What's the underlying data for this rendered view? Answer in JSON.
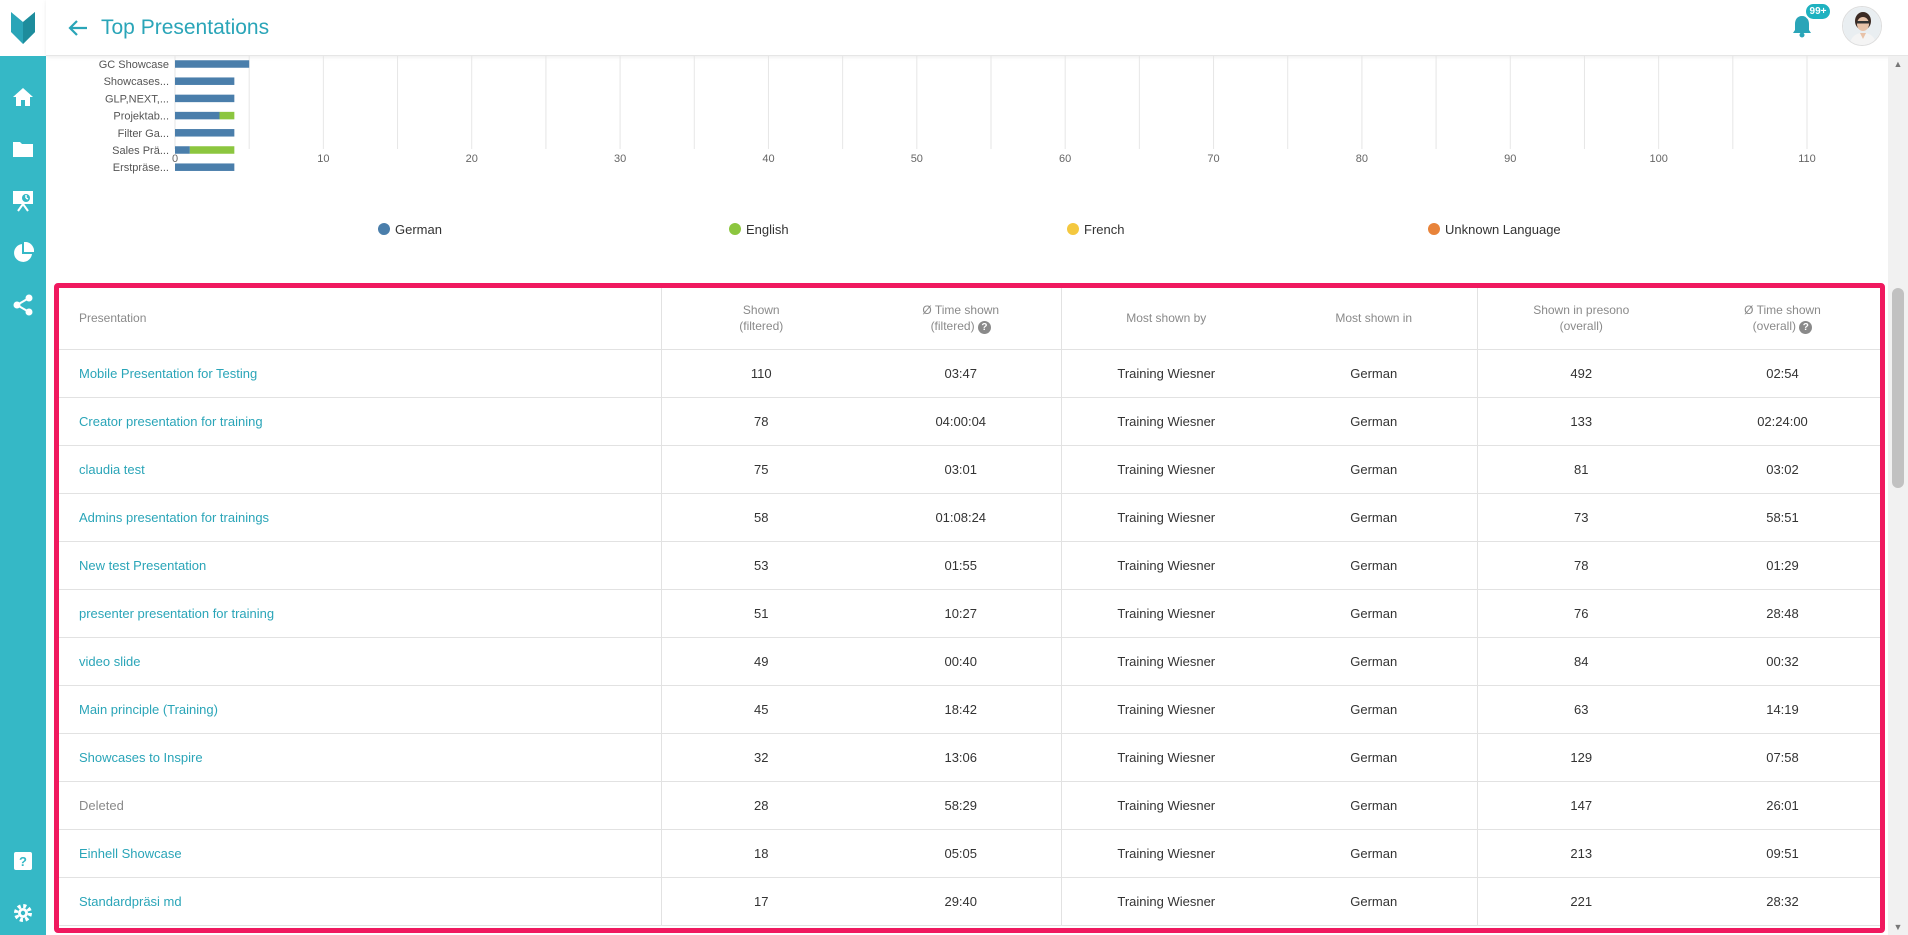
{
  "header": {
    "title": "Top Presentations",
    "notification_badge": "99+"
  },
  "sidebar": {
    "items": [
      "home-icon",
      "folder-icon",
      "presentation-icon",
      "pie-chart-icon",
      "share-icon",
      "help-icon",
      "settings-icon"
    ]
  },
  "chart_data": {
    "type": "bar",
    "orientation": "horizontal",
    "stacked": true,
    "categories": [
      "GC Showcase",
      "Showcases...",
      "GLP,NEXT,...",
      "Projektab...",
      "Filter Ga...",
      "Sales Prä...",
      "Erstpräse..."
    ],
    "series": [
      {
        "name": "German",
        "color": "#4a7eab",
        "values": [
          5,
          4,
          4,
          3,
          4,
          1,
          4
        ]
      },
      {
        "name": "English",
        "color": "#8cc63f",
        "values": [
          0,
          0,
          0,
          1,
          0,
          3,
          0
        ]
      },
      {
        "name": "French",
        "color": "#f4c83f",
        "values": [
          0,
          0,
          0,
          0,
          0,
          0,
          0
        ]
      },
      {
        "name": "Unknown Language",
        "color": "#e8833a",
        "values": [
          0,
          0,
          0,
          0,
          0,
          0,
          0
        ]
      }
    ],
    "xticks": [
      "0",
      "10",
      "20",
      "30",
      "40",
      "50",
      "60",
      "70",
      "80",
      "90",
      "100",
      "110"
    ],
    "xlim": [
      0,
      110
    ],
    "grid": true,
    "legend": "bottom"
  },
  "table": {
    "headers": {
      "presentation": "Presentation",
      "shown_1": "Shown",
      "shown_2": "(filtered)",
      "time_1": "Ø Time shown",
      "time_2": "(filtered)",
      "by": "Most shown by",
      "in": "Most shown in",
      "overall_1": "Shown in presono",
      "overall_2": "(overall)",
      "otime_1": "Ø Time shown",
      "otime_2": "(overall)"
    },
    "rows": [
      {
        "name": "Mobile Presentation for Testing",
        "shown": "110",
        "time": "03:47",
        "by": "Training Wiesner",
        "lang": "German",
        "overall": "492",
        "otime": "02:54"
      },
      {
        "name": "Creator presentation for training",
        "shown": "78",
        "time": "04:00:04",
        "by": "Training Wiesner",
        "lang": "German",
        "overall": "133",
        "otime": "02:24:00"
      },
      {
        "name": "claudia test",
        "shown": "75",
        "time": "03:01",
        "by": "Training Wiesner",
        "lang": "German",
        "overall": "81",
        "otime": "03:02"
      },
      {
        "name": "Admins presentation for trainings",
        "shown": "58",
        "time": "01:08:24",
        "by": "Training Wiesner",
        "lang": "German",
        "overall": "73",
        "otime": "58:51"
      },
      {
        "name": "New test Presentation",
        "shown": "53",
        "time": "01:55",
        "by": "Training Wiesner",
        "lang": "German",
        "overall": "78",
        "otime": "01:29"
      },
      {
        "name": "presenter presentation for training",
        "shown": "51",
        "time": "10:27",
        "by": "Training Wiesner",
        "lang": "German",
        "overall": "76",
        "otime": "28:48"
      },
      {
        "name": "video slide",
        "shown": "49",
        "time": "00:40",
        "by": "Training Wiesner",
        "lang": "German",
        "overall": "84",
        "otime": "00:32"
      },
      {
        "name": "Main principle (Training)",
        "shown": "45",
        "time": "18:42",
        "by": "Training Wiesner",
        "lang": "German",
        "overall": "63",
        "otime": "14:19"
      },
      {
        "name": "Showcases to Inspire",
        "shown": "32",
        "time": "13:06",
        "by": "Training Wiesner",
        "lang": "German",
        "overall": "129",
        "otime": "07:58"
      },
      {
        "name": "Deleted",
        "shown": "28",
        "time": "58:29",
        "by": "Training Wiesner",
        "lang": "German",
        "overall": "147",
        "otime": "26:01",
        "muted": true
      },
      {
        "name": "Einhell Showcase",
        "shown": "18",
        "time": "05:05",
        "by": "Training Wiesner",
        "lang": "German",
        "overall": "213",
        "otime": "09:51"
      },
      {
        "name": "Standardpräsi md",
        "shown": "17",
        "time": "29:40",
        "by": "Training Wiesner",
        "lang": "German",
        "overall": "221",
        "otime": "28:32"
      }
    ]
  }
}
